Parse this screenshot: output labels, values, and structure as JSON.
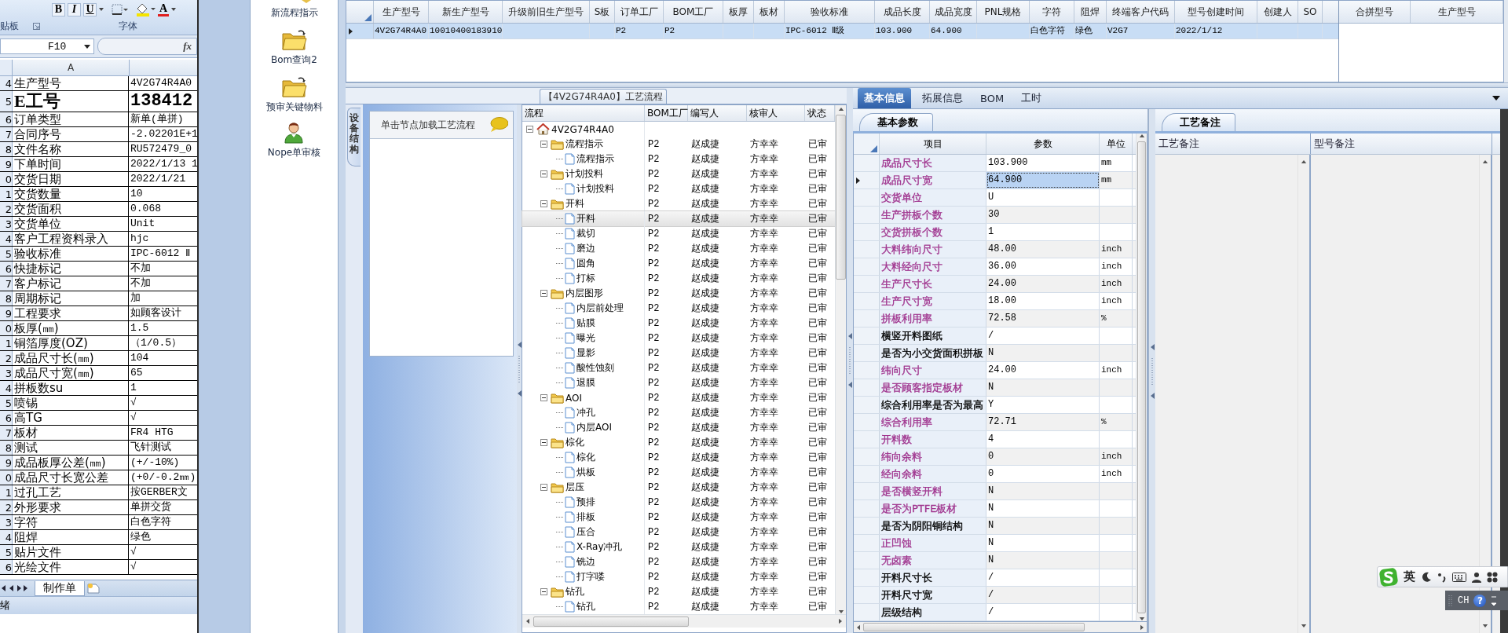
{
  "excel": {
    "format_buttons": [
      "B",
      "I",
      "U"
    ],
    "font_color_label": "A",
    "ribbon_groups": [
      "贴板",
      "字体"
    ],
    "name_box": "F10",
    "formula_label": "fx",
    "column_header": "A",
    "rows": [
      {
        "row_number": "4",
        "label": "生产型号",
        "value": "4V2G74R4A0",
        "kind": "normal"
      },
      {
        "row_number": "5",
        "label": "E工号",
        "value": "138412",
        "kind": "large"
      },
      {
        "row_number": "6",
        "label": "订单类型",
        "value": "新单(单拼)",
        "kind": "normal"
      },
      {
        "row_number": "7",
        "label": "合同序号",
        "value": "-2.02201E+1",
        "kind": "normal"
      },
      {
        "row_number": "8",
        "label": "文件名称",
        "value": "RU572479_0",
        "kind": "normal"
      },
      {
        "row_number": "9",
        "label": "下单时间",
        "value": "2022/1/13 1",
        "kind": "normal"
      },
      {
        "row_number": "0",
        "label": "交货日期",
        "value": "2022/1/21",
        "kind": "normal"
      },
      {
        "row_number": "1",
        "label": "交货数量",
        "value": "10",
        "kind": "normal"
      },
      {
        "row_number": "2",
        "label": "交货面积",
        "value": "0.068",
        "kind": "normal"
      },
      {
        "row_number": "3",
        "label": "交货单位",
        "value": "Unit",
        "kind": "normal"
      },
      {
        "row_number": "4",
        "label": "客户工程资料录入",
        "value": "hjc",
        "kind": "normal"
      },
      {
        "row_number": "5",
        "label": "验收标准",
        "value": "IPC-6012 Ⅱ",
        "kind": "normal"
      },
      {
        "row_number": "6",
        "label": "快捷标记",
        "value": "不加",
        "kind": "normal"
      },
      {
        "row_number": "7",
        "label": "客户标记",
        "value": "不加",
        "kind": "normal"
      },
      {
        "row_number": "8",
        "label": "周期标记",
        "value": "加",
        "kind": "normal"
      },
      {
        "row_number": "9",
        "label": "工程要求",
        "value": "如顾客设计",
        "kind": "normal"
      },
      {
        "row_number": "0",
        "label": "板厚(㎜)",
        "value": "1.5",
        "kind": "normal"
      },
      {
        "row_number": "1",
        "label": "铜箔厚度(OZ)",
        "value": "（1/0.5）",
        "kind": "normal"
      },
      {
        "row_number": "2",
        "label": "成品尺寸长(㎜)",
        "value": "104",
        "kind": "normal"
      },
      {
        "row_number": "3",
        "label": "成品尺寸宽(㎜)",
        "value": "65",
        "kind": "normal"
      },
      {
        "row_number": "4",
        "label": "拼板数su",
        "value": "1",
        "kind": "normal"
      },
      {
        "row_number": "5",
        "label": "喷锡",
        "value": "√",
        "kind": "normal"
      },
      {
        "row_number": "6",
        "label": "高TG",
        "value": "√",
        "kind": "normal"
      },
      {
        "row_number": "7",
        "label": "板材",
        "value": "FR4 HTG",
        "kind": "normal"
      },
      {
        "row_number": "8",
        "label": "测试",
        "value": "飞针测试",
        "kind": "normal"
      },
      {
        "row_number": "9",
        "label": "成品板厚公差(㎜)",
        "value": "(+/-10%)",
        "kind": "normal"
      },
      {
        "row_number": "0",
        "label": "成品尺寸长宽公差",
        "value": "(+0/-0.2㎜)",
        "kind": "normal"
      },
      {
        "row_number": "1",
        "label": "过孔工艺",
        "value": "按GERBER文",
        "kind": "normal"
      },
      {
        "row_number": "2",
        "label": "外形要求",
        "value": "单拼交货",
        "kind": "normal"
      },
      {
        "row_number": "3",
        "label": "字符",
        "value": "白色字符",
        "kind": "normal"
      },
      {
        "row_number": "4",
        "label": "阻焊",
        "value": "绿色",
        "kind": "normal"
      },
      {
        "row_number": "5",
        "label": "贴片文件",
        "value": "√",
        "kind": "normal"
      },
      {
        "row_number": "6",
        "label": "光绘文件",
        "value": "√",
        "kind": "normal"
      }
    ],
    "sheet_tabs": [
      {
        "label": "制作单",
        "selected": true
      }
    ],
    "status": "绪"
  },
  "quick_launch": [
    {
      "label": "新流程指示",
      "kind": "pencil"
    },
    {
      "label": "Bom查询2",
      "kind": "folder"
    },
    {
      "label": "预审关键物料",
      "kind": "folder"
    },
    {
      "label": "Nope单审核",
      "kind": "person"
    }
  ],
  "top_grid": {
    "columns": [
      "生产型号",
      "新生产型号",
      "升级前旧生产型号",
      "S板",
      "订单工厂",
      "BOM工厂",
      "板厚",
      "板材",
      "验收标准",
      "成品长度",
      "成品宽度",
      "PNL规格",
      "字符",
      "阻焊",
      "终端客户代码",
      "型号创建时间",
      "创建人",
      "SO"
    ],
    "rows": [
      {
        "selected": true,
        "cells": [
          "4V2G74R4A0",
          "10010400183910",
          null,
          null,
          "P2",
          "P2",
          null,
          null,
          "IPC-6012 Ⅱ级",
          "103.900",
          "64.900",
          null,
          "白色字符",
          "绿色",
          "V2G7",
          "2022/1/12",
          null,
          null
        ]
      }
    ]
  },
  "side_grid": {
    "columns": [
      "合拼型号",
      "生产型号"
    ]
  },
  "process": {
    "title": "【4V2G74R4A0】工艺流程",
    "side_tab": "设备结构",
    "hint": "单击节点加载工艺流程",
    "tree": {
      "columns": [
        "流程",
        "BOM工厂",
        "编写人",
        "核审人",
        "状态"
      ],
      "root": {
        "name": "4V2G74R4A0",
        "selected": false,
        "expanded": true,
        "children": [
          {
            "name": "流程指示",
            "bom": "P2",
            "writer": "赵成捷",
            "reviewer": "方幸幸",
            "status": "已审",
            "selected": false,
            "expanded": true,
            "children": [
              {
                "name": "流程指示",
                "bom": "P2",
                "writer": "赵成捷",
                "reviewer": "方幸幸",
                "status": "已审",
                "selected": false
              }
            ]
          },
          {
            "name": "计划投料",
            "bom": "P2",
            "writer": "赵成捷",
            "reviewer": "方幸幸",
            "status": "已审",
            "selected": false,
            "expanded": true,
            "children": [
              {
                "name": "计划投料",
                "bom": "P2",
                "writer": "赵成捷",
                "reviewer": "方幸幸",
                "status": "已审",
                "selected": false
              }
            ]
          },
          {
            "name": "开料",
            "bom": "P2",
            "writer": "赵成捷",
            "reviewer": "方幸幸",
            "status": "已审",
            "selected": false,
            "expanded": true,
            "children": [
              {
                "name": "开料",
                "bom": "P2",
                "writer": "赵成捷",
                "reviewer": "方幸幸",
                "status": "已审",
                "selected": true
              },
              {
                "name": "裁切",
                "bom": "P2",
                "writer": "赵成捷",
                "reviewer": "方幸幸",
                "status": "已审",
                "selected": false
              },
              {
                "name": "磨边",
                "bom": "P2",
                "writer": "赵成捷",
                "reviewer": "方幸幸",
                "status": "已审",
                "selected": false
              },
              {
                "name": "圆角",
                "bom": "P2",
                "writer": "赵成捷",
                "reviewer": "方幸幸",
                "status": "已审",
                "selected": false
              },
              {
                "name": "打标",
                "bom": "P2",
                "writer": "赵成捷",
                "reviewer": "方幸幸",
                "status": "已审",
                "selected": false
              }
            ]
          },
          {
            "name": "内层图形",
            "bom": "P2",
            "writer": "赵成捷",
            "reviewer": "方幸幸",
            "status": "已审",
            "selected": false,
            "expanded": true,
            "children": [
              {
                "name": "内层前处理",
                "bom": "P2",
                "writer": "赵成捷",
                "reviewer": "方幸幸",
                "status": "已审",
                "selected": false
              },
              {
                "name": "贴膜",
                "bom": "P2",
                "writer": "赵成捷",
                "reviewer": "方幸幸",
                "status": "已审",
                "selected": false
              },
              {
                "name": "曝光",
                "bom": "P2",
                "writer": "赵成捷",
                "reviewer": "方幸幸",
                "status": "已审",
                "selected": false
              },
              {
                "name": "显影",
                "bom": "P2",
                "writer": "赵成捷",
                "reviewer": "方幸幸",
                "status": "已审",
                "selected": false
              },
              {
                "name": "酸性蚀刻",
                "bom": "P2",
                "writer": "赵成捷",
                "reviewer": "方幸幸",
                "status": "已审",
                "selected": false
              },
              {
                "name": "退膜",
                "bom": "P2",
                "writer": "赵成捷",
                "reviewer": "方幸幸",
                "status": "已审",
                "selected": false
              }
            ]
          },
          {
            "name": "AOI",
            "bom": "P2",
            "writer": "赵成捷",
            "reviewer": "方幸幸",
            "status": "已审",
            "selected": false,
            "expanded": true,
            "children": [
              {
                "name": "冲孔",
                "bom": "P2",
                "writer": "赵成捷",
                "reviewer": "方幸幸",
                "status": "已审",
                "selected": false
              },
              {
                "name": "内层AOI",
                "bom": "P2",
                "writer": "赵成捷",
                "reviewer": "方幸幸",
                "status": "已审",
                "selected": false
              }
            ]
          },
          {
            "name": "棕化",
            "bom": "P2",
            "writer": "赵成捷",
            "reviewer": "方幸幸",
            "status": "已审",
            "selected": false,
            "expanded": true,
            "children": [
              {
                "name": "棕化",
                "bom": "P2",
                "writer": "赵成捷",
                "reviewer": "方幸幸",
                "status": "已审",
                "selected": false
              },
              {
                "name": "烘板",
                "bom": "P2",
                "writer": "赵成捷",
                "reviewer": "方幸幸",
                "status": "已审",
                "selected": false
              }
            ]
          },
          {
            "name": "层压",
            "bom": "P2",
            "writer": "赵成捷",
            "reviewer": "方幸幸",
            "status": "已审",
            "selected": false,
            "expanded": true,
            "children": [
              {
                "name": "预排",
                "bom": "P2",
                "writer": "赵成捷",
                "reviewer": "方幸幸",
                "status": "已审",
                "selected": false
              },
              {
                "name": "排板",
                "bom": "P2",
                "writer": "赵成捷",
                "reviewer": "方幸幸",
                "status": "已审",
                "selected": false
              },
              {
                "name": "压合",
                "bom": "P2",
                "writer": "赵成捷",
                "reviewer": "方幸幸",
                "status": "已审",
                "selected": false
              },
              {
                "name": "X-Ray冲孔",
                "bom": "P2",
                "writer": "赵成捷",
                "reviewer": "方幸幸",
                "status": "已审",
                "selected": false
              },
              {
                "name": "铣边",
                "bom": "P2",
                "writer": "赵成捷",
                "reviewer": "方幸幸",
                "status": "已审",
                "selected": false
              },
              {
                "name": "打字喽",
                "bom": "P2",
                "writer": "赵成捷",
                "reviewer": "方幸幸",
                "status": "已审",
                "selected": false
              }
            ]
          },
          {
            "name": "钻孔",
            "bom": "P2",
            "writer": "赵成捷",
            "reviewer": "方幸幸",
            "status": "已审",
            "selected": false,
            "expanded": true,
            "children": [
              {
                "name": "钻孔",
                "bom": "P2",
                "writer": "赵成捷",
                "reviewer": "方幸幸",
                "status": "已审",
                "selected": false
              }
            ]
          }
        ]
      }
    }
  },
  "detail_tabs": [
    {
      "label": "基本信息",
      "selected": true
    },
    {
      "label": "拓展信息",
      "selected": false
    },
    {
      "label": "BOM",
      "selected": false
    },
    {
      "label": "工时",
      "selected": false
    }
  ],
  "params": {
    "sub_tab": "基本参数",
    "columns": [
      "项目",
      "参数",
      "单位"
    ],
    "rows": [
      {
        "item": "成品尺寸长",
        "value": "103.900",
        "unit": "mm",
        "color": "#a0358f",
        "selected": false
      },
      {
        "item": "成品尺寸宽",
        "value": "64.900",
        "unit": "mm",
        "color": "#a0358f",
        "selected": true
      },
      {
        "item": "交货单位",
        "value": "U",
        "color": "#a0358f",
        "selected": false
      },
      {
        "item": "生产拼板个数",
        "value": "30",
        "color": "#a0358f",
        "selected": false
      },
      {
        "item": "交货拼板个数",
        "value": "1",
        "color": "#a0358f",
        "selected": false
      },
      {
        "item": "大料纬向尺寸",
        "value": "48.00",
        "unit": "inch",
        "color": "#a0358f",
        "selected": false
      },
      {
        "item": "大料经向尺寸",
        "value": "36.00",
        "unit": "inch",
        "color": "#a0358f",
        "selected": false
      },
      {
        "item": "生产尺寸长",
        "value": "24.00",
        "unit": "inch",
        "color": "#a0358f",
        "selected": false
      },
      {
        "item": "生产尺寸宽",
        "value": "18.00",
        "unit": "inch",
        "color": "#a0358f",
        "selected": false
      },
      {
        "item": "拼板利用率",
        "value": "72.58",
        "unit": "%",
        "color": "#a0358f",
        "selected": false
      },
      {
        "item": "横竖开料图纸",
        "value": "/",
        "color": "#000000",
        "selected": false
      },
      {
        "item": "是否为小交货面积拼板",
        "value": "N",
        "color": "#000000",
        "selected": false
      },
      {
        "item": "纬向尺寸",
        "value": "24.00",
        "unit": "inch",
        "color": "#a0358f",
        "selected": false
      },
      {
        "item": "是否顾客指定板材",
        "value": "N",
        "color": "#a0358f",
        "selected": false
      },
      {
        "item": "综合利用率是否为最高",
        "value": "Y",
        "color": "#000000",
        "selected": false
      },
      {
        "item": "综合利用率",
        "value": "72.71",
        "unit": "%",
        "color": "#a0358f",
        "selected": false
      },
      {
        "item": "开料数",
        "value": "4",
        "color": "#a0358f",
        "selected": false
      },
      {
        "item": "纬向余料",
        "value": "0",
        "unit": "inch",
        "color": "#a0358f",
        "selected": false
      },
      {
        "item": "经向余料",
        "value": "0",
        "unit": "inch",
        "color": "#a0358f",
        "selected": false
      },
      {
        "item": "是否横竖开料",
        "value": "N",
        "color": "#a0358f",
        "selected": false
      },
      {
        "item": "是否为PTFE板材",
        "value": "N",
        "color": "#a0358f",
        "selected": false
      },
      {
        "item": "是否为阴阳铜结构",
        "value": "N",
        "color": "#000000",
        "selected": false
      },
      {
        "item": "正凹蚀",
        "value": "N",
        "color": "#a0358f",
        "selected": false
      },
      {
        "item": "无卤素",
        "value": "N",
        "color": "#a0358f",
        "selected": false
      },
      {
        "item": "开料尺寸长",
        "value": "/",
        "color": "#000000",
        "selected": false
      },
      {
        "item": "开料尺寸宽",
        "value": "/",
        "color": "#000000",
        "selected": false
      },
      {
        "item": "层级结构",
        "value": "/",
        "color": "#000000",
        "selected": false
      }
    ]
  },
  "remarks": {
    "sub_tab": "工艺备注",
    "columns": [
      "工艺备注",
      "型号备注"
    ]
  },
  "ime": {
    "mode": "英"
  },
  "language_bar": {
    "code": "CH",
    "help": "?"
  }
}
